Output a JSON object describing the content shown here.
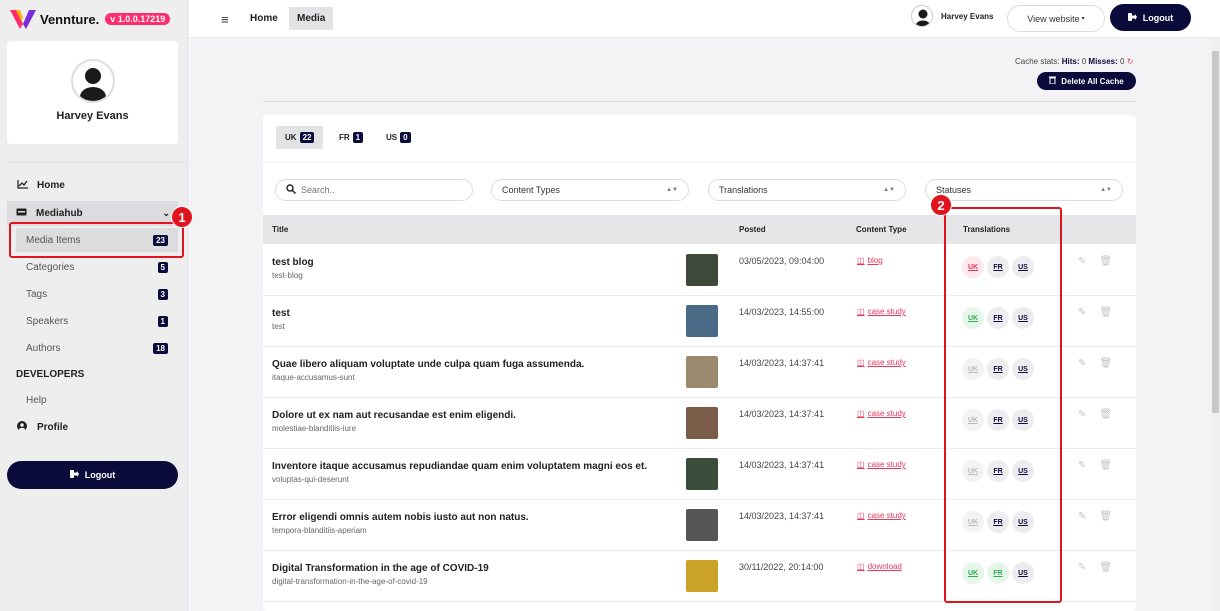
{
  "brand": {
    "name": "Vennture.",
    "version": "v 1.0.0.17219"
  },
  "user": {
    "name": "Harvey Evans"
  },
  "sidebar": {
    "home": "Home",
    "group": "Mediahub",
    "items": [
      {
        "label": "Media Items",
        "count": "23"
      },
      {
        "label": "Categories",
        "count": "5"
      },
      {
        "label": "Tags",
        "count": "3"
      },
      {
        "label": "Speakers",
        "count": "1"
      },
      {
        "label": "Authors",
        "count": "18"
      }
    ],
    "developers": "DEVELOPERS",
    "help": "Help",
    "profile": "Profile",
    "logout": "Logout"
  },
  "topbar": {
    "breadcrumbs": [
      "Home",
      "Media"
    ],
    "user": "Harvey Evans",
    "view_website": "View website",
    "logout": "Logout"
  },
  "cache": {
    "label": "Cache stats:",
    "hits_label": "Hits:",
    "hits": "0",
    "misses_label": "Misses:",
    "misses": "0",
    "delete_label": "Delete All Cache"
  },
  "tabs": [
    {
      "label": "UK",
      "count": "22"
    },
    {
      "label": "FR",
      "count": "1"
    },
    {
      "label": "US",
      "count": "0"
    }
  ],
  "filters": {
    "search_placeholder": "Search..",
    "content_types": "Content Types",
    "translations": "Translations",
    "statuses": "Statuses"
  },
  "table": {
    "headers": {
      "title": "Title",
      "posted": "Posted",
      "content_type": "Content Type",
      "translations": "Translations"
    },
    "rows": [
      {
        "title": "test blog",
        "slug": "test-blog",
        "posted": "03/05/2023, 09:04:00",
        "type": "blog",
        "thumb": "#3d4a3a",
        "trans": [
          "red",
          "dark",
          "dark"
        ]
      },
      {
        "title": "test",
        "slug": "test",
        "posted": "14/03/2023, 14:55:00",
        "type": "case study",
        "thumb": "#4a6a88",
        "trans": [
          "green",
          "dark",
          "dark"
        ]
      },
      {
        "title": "Quae libero aliquam voluptate unde culpa quam fuga assumenda.",
        "slug": "itaque-accusamus-sunt",
        "posted": "14/03/2023, 14:37:41",
        "type": "case study",
        "thumb": "#9b8a6e",
        "trans": [
          "grey",
          "dark",
          "dark"
        ]
      },
      {
        "title": "Dolore ut ex nam aut recusandae est enim eligendi.",
        "slug": "molestiae-blanditiis-iure",
        "posted": "14/03/2023, 14:37:41",
        "type": "case study",
        "thumb": "#7a5c48",
        "trans": [
          "grey",
          "dark",
          "dark"
        ]
      },
      {
        "title": "Inventore itaque accusamus repudiandae quam enim voluptatem magni eos et.",
        "slug": "voluptas-qui-deserunt",
        "posted": "14/03/2023, 14:37:41",
        "type": "case study",
        "thumb": "#3a4c3a",
        "trans": [
          "grey",
          "dark",
          "dark"
        ]
      },
      {
        "title": "Error eligendi omnis autem nobis iusto aut non natus.",
        "slug": "tempora-blanditiis-aperiam",
        "posted": "14/03/2023, 14:37:41",
        "type": "case study",
        "thumb": "#555558",
        "trans": [
          "grey",
          "dark",
          "dark"
        ]
      },
      {
        "title": "Digital Transformation in the age of COVID-19",
        "slug": "digital-transformation-in-the-age-of-covid-19",
        "posted": "30/11/2022, 20:14:00",
        "type": "download",
        "thumb": "#c9a227",
        "trans": [
          "green",
          "green",
          "dark"
        ]
      }
    ],
    "trans_labels": [
      "UK",
      "FR",
      "US"
    ]
  },
  "annotations": [
    "1",
    "2"
  ],
  "colors": {
    "navy": "#0b0b3b",
    "accent": "#ff2d6b",
    "highlight": "#e0131f"
  }
}
